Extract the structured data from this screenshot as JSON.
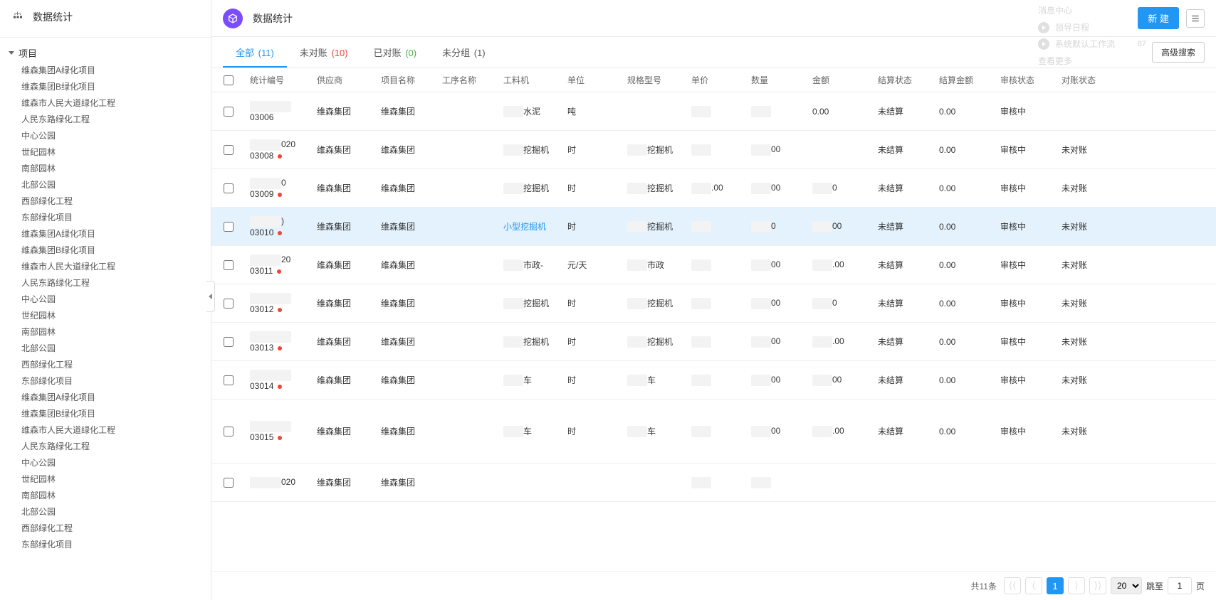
{
  "sidebar": {
    "title": "数据统计",
    "root": "项目",
    "items": [
      "维森集团A绿化项目",
      "维森集团B绿化项目",
      "维森市人民大道绿化工程",
      "人民东路绿化工程",
      "中心公园",
      "世纪园林",
      "南部园林",
      "北部公园",
      "西部绿化工程",
      "东部绿化项目",
      "维森集团A绿化项目",
      "维森集团B绿化项目",
      "维森市人民大道绿化工程",
      "人民东路绿化工程",
      "中心公园",
      "世纪园林",
      "南部园林",
      "北部公园",
      "西部绿化工程",
      "东部绿化项目",
      "维森集团A绿化项目",
      "维森集团B绿化项目",
      "维森市人民大道绿化工程",
      "人民东路绿化工程",
      "中心公园",
      "世纪园林",
      "南部园林",
      "北部公园",
      "西部绿化工程",
      "东部绿化项目"
    ]
  },
  "header": {
    "title": "数据统计",
    "new_btn": "新 建",
    "notif": {
      "title": "消息中心",
      "rows": [
        {
          "label": "领导日程",
          "badge": ""
        },
        {
          "label": "系统默认工作流",
          "badge": "87"
        }
      ],
      "more": "查看更多"
    }
  },
  "tabs": {
    "items": [
      {
        "label": "全部",
        "count": "(11)",
        "cls": "blue",
        "active": true
      },
      {
        "label": "未对账",
        "count": "(10)",
        "cls": "red",
        "active": false
      },
      {
        "label": "已对账",
        "count": "(0)",
        "cls": "green",
        "active": false
      },
      {
        "label": "未分组",
        "count": "(1)",
        "cls": "",
        "active": false
      }
    ],
    "adv_search": "高级搜索"
  },
  "table": {
    "cols": [
      "统计编号",
      "供应商",
      "项目名称",
      "工序名称",
      "工料机",
      "单位",
      "规格型号",
      "单价",
      "数量",
      "金额",
      "结算状态",
      "结算金额",
      "审核状态",
      "对账状态"
    ],
    "rows": [
      {
        "id": "03006",
        "dot": false,
        "id_extra": "",
        "sup": "维森集团",
        "proj": "维森集团",
        "proc": "",
        "mat": "水泥",
        "unit": "吨",
        "spec": "",
        "price": "",
        "qty": "",
        "amt": "0.00",
        "set": "未结算",
        "setamt": "0.00",
        "audit": "审核中",
        "recon": "",
        "hl": false
      },
      {
        "id": "03008",
        "dot": true,
        "id_extra": "020",
        "sup": "维森集团",
        "proj": "维森集团",
        "proc": "",
        "mat": "挖掘机",
        "unit": "时",
        "spec": "挖掘机",
        "price": "",
        "qty": "00",
        "amt": "",
        "set": "未结算",
        "setamt": "0.00",
        "audit": "审核中",
        "recon": "未对账",
        "hl": false
      },
      {
        "id": "03009",
        "dot": true,
        "id_extra": "0",
        "sup": "维森集团",
        "proj": "维森集团",
        "proc": "",
        "mat": "挖掘机",
        "unit": "时",
        "spec": "挖掘机",
        "price": ".00",
        "qty": "00",
        "amt": "0",
        "set": "未结算",
        "setamt": "0.00",
        "audit": "审核中",
        "recon": "未对账",
        "hl": false
      },
      {
        "id": "03010",
        "dot": true,
        "id_extra": ")",
        "sup": "维森集团",
        "proj": "维森集团",
        "proc": "",
        "mat": "小型挖掘机",
        "mat_link": true,
        "unit": "时",
        "spec": "挖掘机",
        "price": "",
        "qty": "0",
        "amt": "00",
        "set": "未结算",
        "setamt": "0.00",
        "audit": "审核中",
        "recon": "未对账",
        "hl": true
      },
      {
        "id": "03011",
        "dot": true,
        "id_extra": "20",
        "sup": "维森集团",
        "proj": "维森集团",
        "proc": "",
        "mat": "市政-",
        "unit": "元/天",
        "spec": "市政",
        "price": "",
        "qty": "00",
        "amt": ".00",
        "set": "未结算",
        "setamt": "0.00",
        "audit": "审核中",
        "recon": "未对账",
        "hl": false
      },
      {
        "id": "03012",
        "dot": true,
        "id_extra": "",
        "sup": "维森集团",
        "proj": "维森集团",
        "proc": "",
        "mat": "挖掘机",
        "unit": "时",
        "spec": "挖掘机",
        "price": "",
        "qty": "00",
        "amt": "0",
        "set": "未结算",
        "setamt": "0.00",
        "audit": "审核中",
        "recon": "未对账",
        "hl": false
      },
      {
        "id": "03013",
        "dot": true,
        "id_extra": "",
        "sup": "维森集团",
        "proj": "维森集团",
        "proc": "",
        "mat": "挖掘机",
        "unit": "时",
        "spec": "挖掘机",
        "price": "",
        "qty": "00",
        "amt": ".00",
        "set": "未结算",
        "setamt": "0.00",
        "audit": "审核中",
        "recon": "未对账",
        "hl": false
      },
      {
        "id": "03014",
        "dot": true,
        "id_extra": "",
        "sup": "维森集团",
        "proj": "维森集团",
        "proc": "",
        "mat": "车",
        "unit": "时",
        "spec": "车",
        "price": "",
        "qty": "00",
        "amt": "00",
        "set": "未结算",
        "setamt": "0.00",
        "audit": "审核中",
        "recon": "未对账",
        "hl": false
      },
      {
        "id": "03015",
        "dot": true,
        "id_extra": "",
        "sup": "维森集团",
        "proj": "维森集团",
        "proc": "",
        "mat": "车",
        "unit": "时",
        "spec": "车",
        "price": "",
        "qty": "00",
        "amt": ".00",
        "set": "未结算",
        "setamt": "0.00",
        "audit": "审核中",
        "recon": "未对账",
        "hl": false,
        "tall": true
      },
      {
        "id": "",
        "dot": false,
        "id_extra": "020",
        "sup": "维森集团",
        "proj": "维森集团",
        "proc": "",
        "mat": "",
        "unit": "",
        "spec": "",
        "price": "",
        "qty": "",
        "amt": "",
        "set": "",
        "setamt": "",
        "audit": "",
        "recon": "",
        "hl": false
      }
    ]
  },
  "pager": {
    "total": "共11条",
    "page": "1",
    "page_size": "20",
    "jump_label": "跳至",
    "jump_val": "1",
    "page_suffix": "页"
  }
}
